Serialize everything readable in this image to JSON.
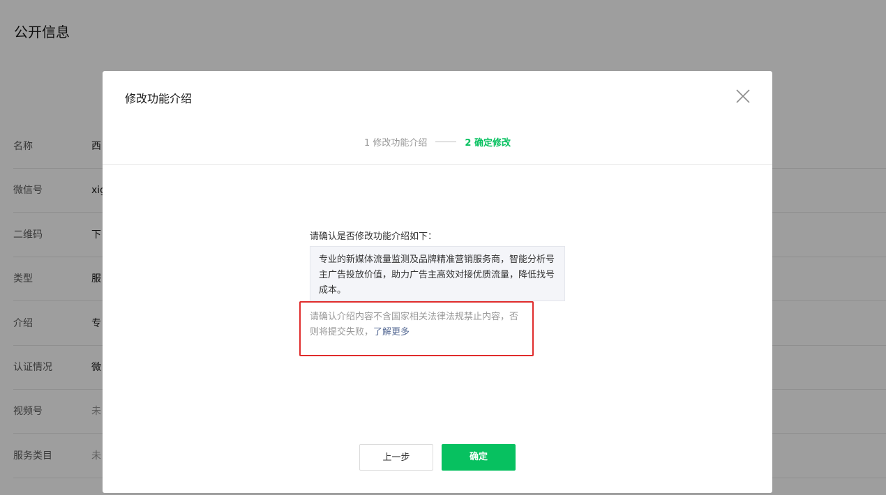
{
  "page": {
    "title": "公开信息",
    "rows": [
      {
        "label": "名称",
        "value": "西",
        "muted": false
      },
      {
        "label": "微信号",
        "value": "xig",
        "muted": false
      },
      {
        "label": "二维码",
        "value": "下",
        "muted": false
      },
      {
        "label": "类型",
        "value": "服",
        "muted": false
      },
      {
        "label": "介绍",
        "value": "专",
        "muted": false
      },
      {
        "label": "认证情况",
        "value": "微",
        "muted": false
      },
      {
        "label": "视频号",
        "value": "未",
        "muted": true
      },
      {
        "label": "服务类目",
        "value": "未",
        "muted": true
      }
    ]
  },
  "dialog": {
    "title": "修改功能介绍",
    "close_icon": "close-icon",
    "steps": [
      {
        "label": "1 修改功能介绍",
        "state": "inactive"
      },
      {
        "label": "2 确定修改",
        "state": "active"
      }
    ],
    "confirm_label": "请确认是否修改功能介绍如下：",
    "intro_text": "专业的新媒体流量监测及品牌精准营销服务商，智能分析号主广告投放价值，助力广告主高效对接优质流量，降低找号成本。",
    "warning_text": "请确认介绍内容不含国家相关法律法规禁止内容，否则将提交失败，",
    "learn_more": "了解更多",
    "prev_button": "上一步",
    "ok_button": "确定"
  },
  "colors": {
    "accent": "#07c160",
    "link": "#576b95",
    "highlight_border": "#e02c2c"
  }
}
